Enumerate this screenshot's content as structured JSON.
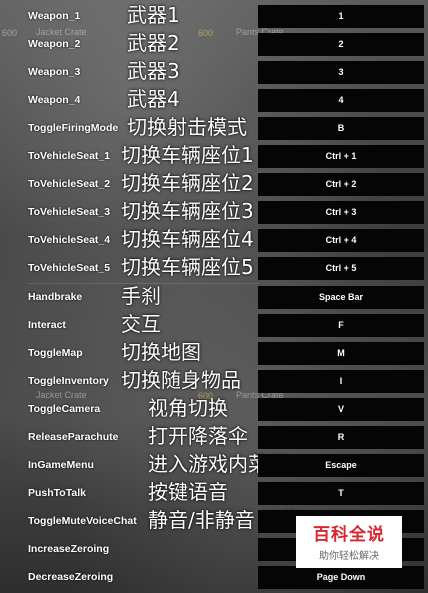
{
  "background": {
    "crate_labels": [
      "Jacket Crate",
      "Pants Crate",
      "Jacket Crate",
      "Pants Crate"
    ],
    "prices": [
      "600",
      "600"
    ],
    "numbers": [
      "600"
    ]
  },
  "bindings": [
    {
      "action": "Weapon_1",
      "label": "武器1",
      "key": "1"
    },
    {
      "action": "Weapon_2",
      "label": "武器2",
      "key": "2"
    },
    {
      "action": "Weapon_3",
      "label": "武器3",
      "key": "3"
    },
    {
      "action": "Weapon_4",
      "label": "武器4",
      "key": "4"
    },
    {
      "action": "ToggleFiringMode",
      "label": "切换射击模式",
      "key": "B"
    },
    {
      "action": "ToVehicleSeat_1",
      "label": "切换车辆座位1",
      "key": "Ctrl + 1"
    },
    {
      "action": "ToVehicleSeat_2",
      "label": "切换车辆座位2",
      "key": "Ctrl + 2"
    },
    {
      "action": "ToVehicleSeat_3",
      "label": "切换车辆座位3",
      "key": "Ctrl + 3"
    },
    {
      "action": "ToVehicleSeat_4",
      "label": "切换车辆座位4",
      "key": "Ctrl + 4"
    },
    {
      "action": "ToVehicleSeat_5",
      "label": "切换车辆座位5",
      "key": "Ctrl + 5"
    },
    {
      "action": "Handbrake",
      "label": "手刹",
      "key": "Space Bar"
    },
    {
      "action": "Interact",
      "label": "交互",
      "key": "F"
    },
    {
      "action": "ToggleMap",
      "label": "切换地图",
      "key": "M"
    },
    {
      "action": "ToggleInventory",
      "label": "切换随身物品",
      "key": "I"
    },
    {
      "action": "ToggleCamera",
      "label": "视角切换",
      "key": "V"
    },
    {
      "action": "ReleaseParachute",
      "label": "打开降落伞",
      "key": "R"
    },
    {
      "action": "InGameMenu",
      "label": "进入游戏内菜单",
      "key": "Escape"
    },
    {
      "action": "PushToTalk",
      "label": "按键语音",
      "key": "T"
    },
    {
      "action": "ToggleMuteVoiceChat",
      "label": "静音/非静音 切换",
      "key": ""
    },
    {
      "action": "IncreaseZeroing",
      "label": "",
      "key": ""
    },
    {
      "action": "DecreaseZeroing",
      "label": "",
      "key": "Page Down"
    }
  ],
  "watermark": {
    "title": "百科全说",
    "subtitle": "助你轻松解决"
  },
  "colors": {
    "key_box": "#050505",
    "text": "#ffffff",
    "watermark_title": "#d8262f"
  }
}
